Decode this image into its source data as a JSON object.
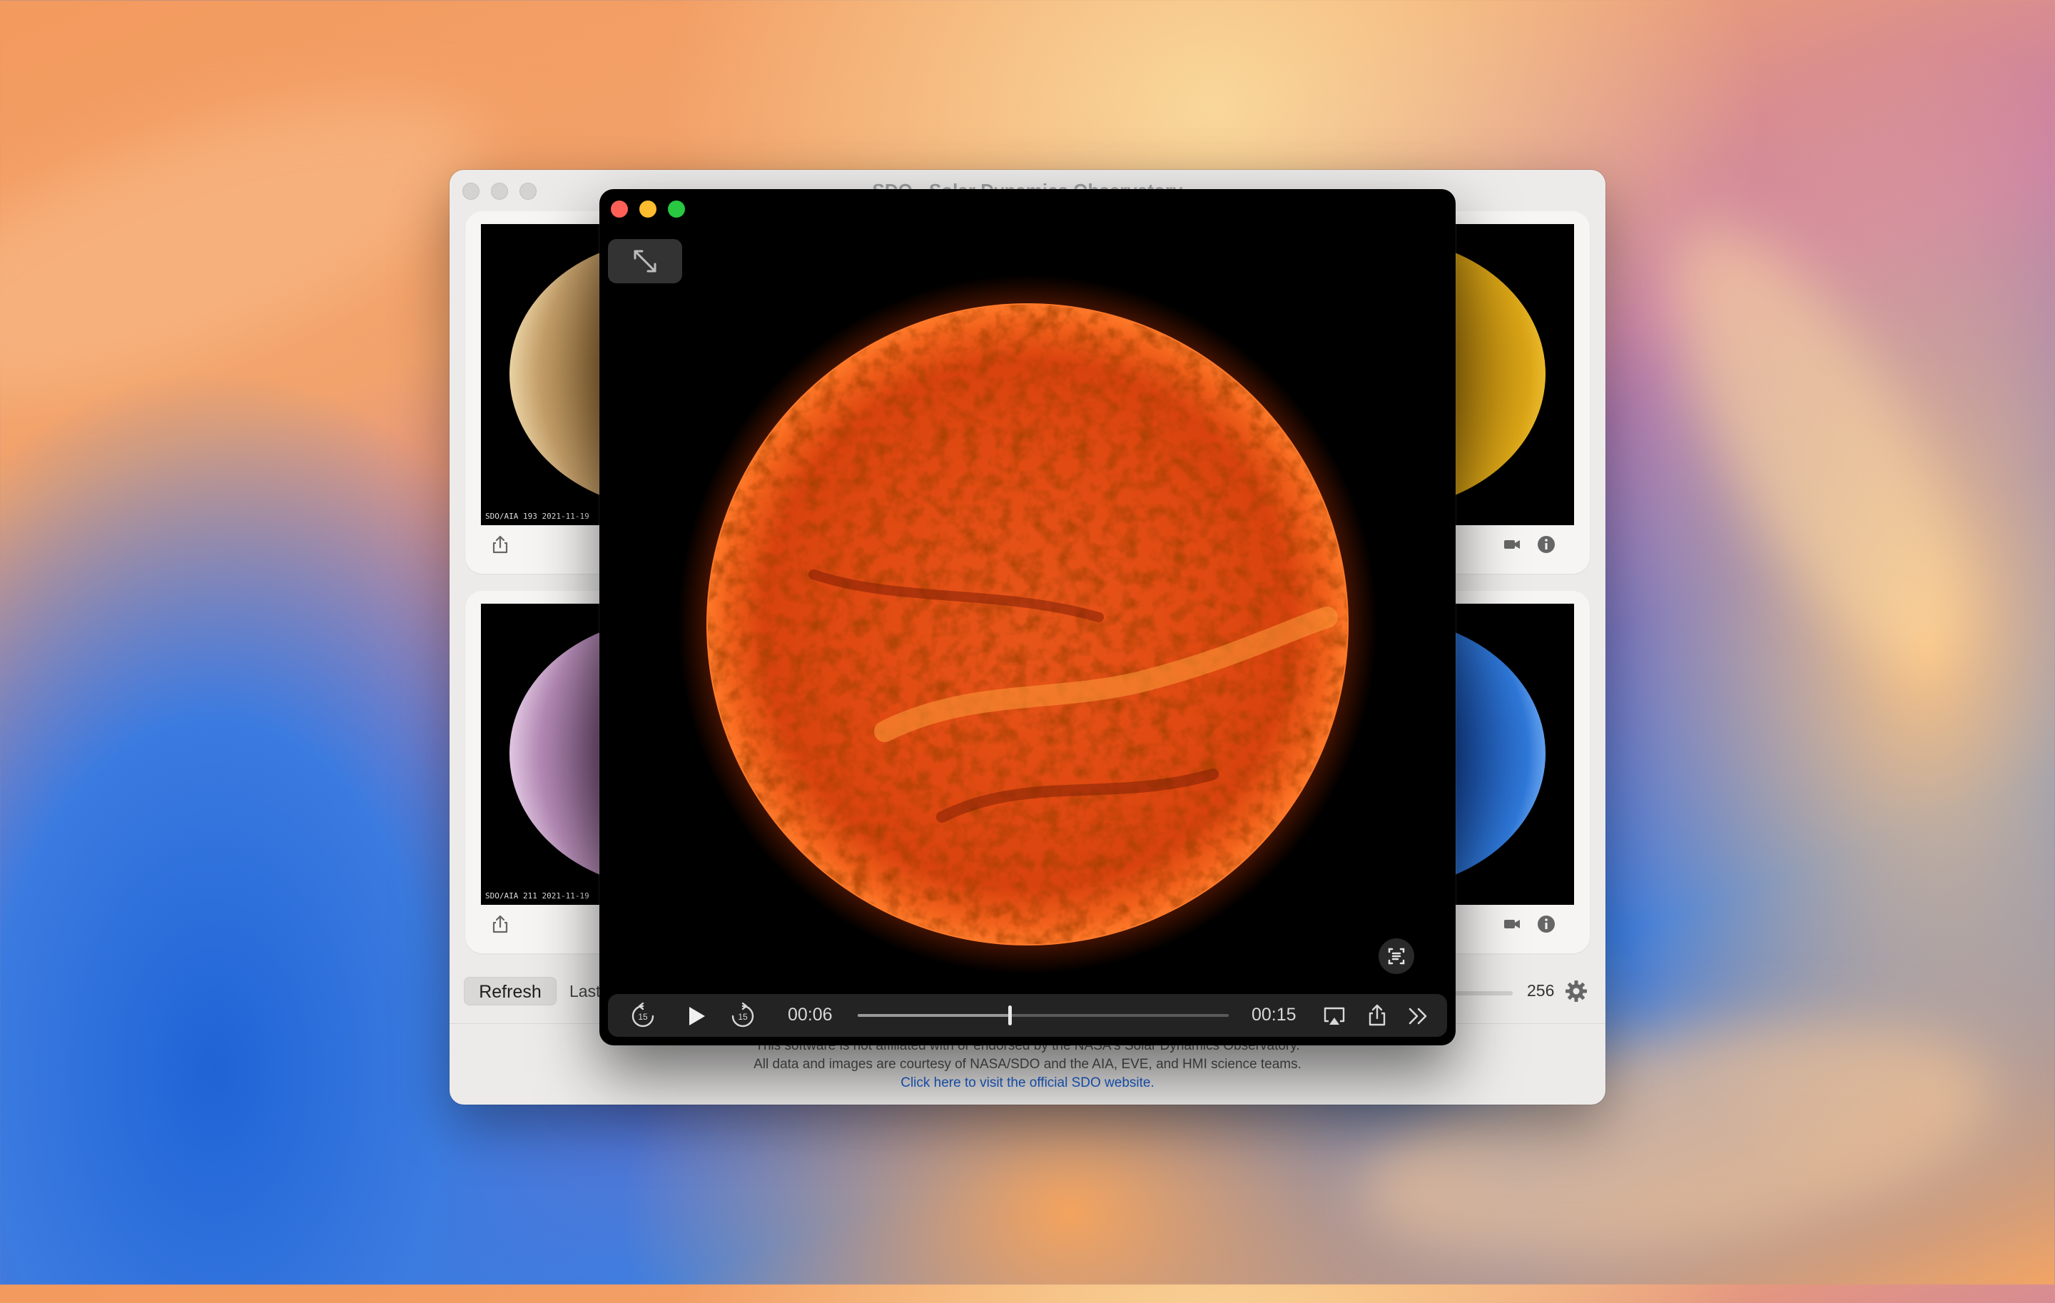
{
  "window": {
    "title": "SDO - Solar Dynamics Observatory"
  },
  "panels": [
    {
      "id": "top-left",
      "caption": "SDO/AIA  193      2021-11-19",
      "tint": "#c49a5a"
    },
    {
      "id": "top-right",
      "caption": "",
      "tint": "#d9a416"
    },
    {
      "id": "bottom-left",
      "caption": "SDO/AIA  211      2021-11-19",
      "tint": "#b58bb6"
    },
    {
      "id": "bottom-right",
      "caption": "",
      "tint": "#2f78d8"
    }
  ],
  "toolbar": {
    "refresh_label": "Refresh",
    "last_label": "Last",
    "resolution_value": "256"
  },
  "footer": {
    "line1": "This software is not affiliated with or endorsed by the NASA's Solar Dynamics Observatory.",
    "line2": "All data and images are courtesy of NASA/SDO and the AIA, EVE, and HMI science teams.",
    "link": "Click here to visit the official SDO website."
  },
  "player": {
    "current_time": "00:06",
    "duration": "00:15",
    "progress": 0.41,
    "skip_back_seconds": "15",
    "skip_forward_seconds": "15",
    "sun_color": "#e64a12"
  }
}
